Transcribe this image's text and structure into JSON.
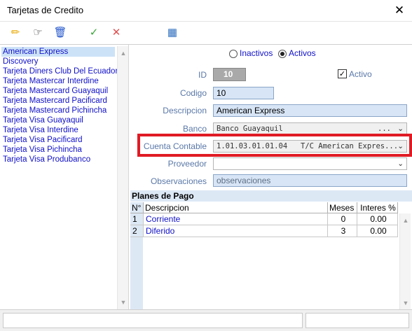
{
  "window": {
    "title": "Tarjetas de Credito",
    "close_glyph": "✕"
  },
  "toolbar": [
    {
      "name": "edit-pencil-icon",
      "glyph": "✏",
      "color": "#e8a800"
    },
    {
      "name": "search-hand-icon",
      "glyph": "☞",
      "color": "#333333"
    },
    {
      "name": "trash-icon",
      "glyph": "🗑",
      "color": "#2255cc"
    },
    {
      "name": "check-icon",
      "glyph": "✓",
      "color": "#3ca63c"
    },
    {
      "name": "cancel-x-icon",
      "glyph": "✕",
      "color": "#e05050"
    },
    {
      "name": "grid-report-icon",
      "glyph": "▦",
      "color": "#2f6fbf"
    }
  ],
  "card_list": [
    "American Express",
    "Discovery",
    "Tarjeta Diners Club Del Ecuador",
    "Tarjeta Mastercar Interdine",
    "Tarjeta Mastercard Guayaquil",
    "Tarjeta Mastercard Pacificard",
    "Tarjeta Mastercard Pichincha",
    "Tarjeta Visa Guayaquil",
    "Tarjeta Visa Interdine",
    "Tarjeta Visa Pacificard",
    "Tarjeta Visa Pichincha",
    "Tarjeta Visa Produbanco"
  ],
  "filter": {
    "inactivos": "Inactivos",
    "activos": "Activos",
    "selected": "Activos"
  },
  "form": {
    "id_label": "ID",
    "id_value": "10",
    "activo_label": "Activo",
    "activo_checked": true,
    "codigo_label": "Codigo",
    "codigo_value": "10",
    "descripcion_label": "Descripcion",
    "descripcion_value": "American Express",
    "banco_label": "Banco",
    "banco_value": "Banco Guayaquil",
    "banco_ellipsis": "...",
    "cuenta_label": "Cuenta Contable",
    "cuenta_code": "1.01.03.01.01.04",
    "cuenta_desc": "T/C American Expres...",
    "proveedor_label": "Proveedor",
    "proveedor_value": "",
    "observaciones_label": "Observaciones",
    "observaciones_placeholder": "observaciones"
  },
  "planes": {
    "title": "Planes de Pago",
    "headers": {
      "n": "N°",
      "descripcion": "Descripcion",
      "meses": "Meses",
      "interes": "Interes %"
    },
    "rows": [
      {
        "n": "1",
        "descripcion": "Corriente",
        "meses": "0",
        "interes": "0.00"
      },
      {
        "n": "2",
        "descripcion": "Diferido",
        "meses": "3",
        "interes": "0.00"
      }
    ]
  },
  "colors": {
    "highlight": "#e01b24",
    "link": "#1010c8",
    "label": "#5a78a8"
  }
}
